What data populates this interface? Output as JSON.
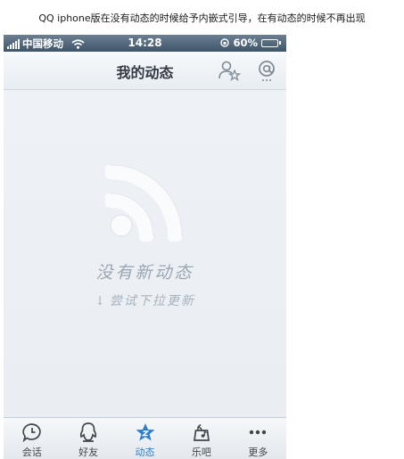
{
  "caption": "QQ iphone版在没有动态的时候给予内嵌式引导，在有动态的时候不再出现",
  "status_bar": {
    "carrier": "中国移动",
    "time": "14:28",
    "battery": "60%",
    "battery_level": 0.6
  },
  "nav": {
    "title": "我的动态",
    "icons": {
      "friends": "friend-star-icon",
      "mention": "at-icon"
    }
  },
  "empty_state": {
    "icon": "feed-rss-icon",
    "title": "没有新动态",
    "hint": "尝试下拉更新"
  },
  "tab_bar": {
    "active": "动态",
    "tabs": [
      {
        "label": "会话",
        "icon": "chat-clock-icon"
      },
      {
        "label": "好友",
        "icon": "penguin-icon"
      },
      {
        "label": "动态",
        "icon": "star-icon"
      },
      {
        "label": "乐吧",
        "icon": "music-stand-icon"
      },
      {
        "label": "更多",
        "icon": "more-dots-icon"
      }
    ]
  },
  "colors": {
    "status_bar": "#4a5f72",
    "tab_active": "#2a7fc8",
    "empty_text": "#9aa7b3"
  }
}
